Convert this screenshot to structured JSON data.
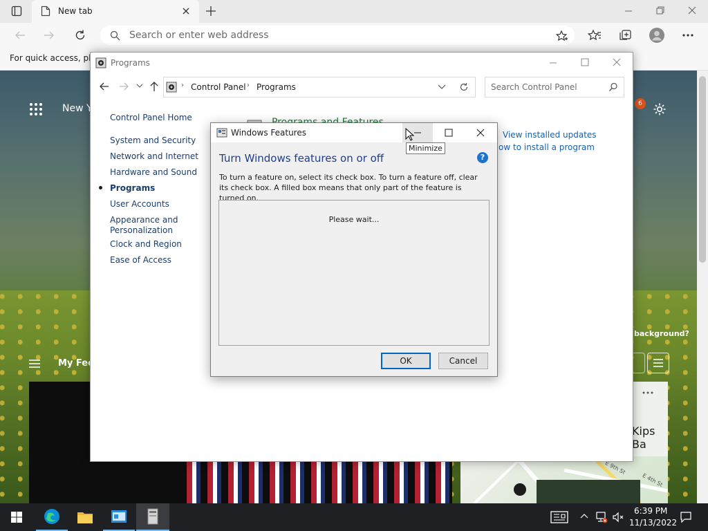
{
  "browser": {
    "tab_title": "New tab",
    "address_placeholder": "Search or enter web address",
    "favorites_text": "For quick access, plac"
  },
  "ntp": {
    "greeting": "New Y",
    "notification_count": "6",
    "my_feed": "My Fee",
    "background_question": "background?",
    "map_title": "Kips Ba",
    "map_streets": [
      "E 9th St",
      "E 4th St"
    ]
  },
  "control_panel": {
    "title": "Programs",
    "breadcrumb": [
      "Control Panel",
      "Programs"
    ],
    "search_placeholder": "Search Control Panel",
    "sidebar_home": "Control Panel Home",
    "categories": [
      "System and Security",
      "Network and Internet",
      "Hardware and Sound",
      "Programs",
      "User Accounts",
      "Appearance and Personalization",
      "Clock and Region",
      "Ease of Access"
    ],
    "current_category": "Programs",
    "section_heading": "Programs and Features",
    "links": [
      "View installed updates",
      "How to install a program"
    ]
  },
  "dialog": {
    "title": "Windows Features",
    "heading": "Turn Windows features on or off",
    "description": "To turn a feature on, select its check box. To turn a feature off, clear its check box. A filled box means that only part of the feature is turned on.",
    "loading": "Please wait...",
    "ok": "OK",
    "cancel": "Cancel",
    "tooltip": "Minimize"
  },
  "taskbar": {
    "time": "6:39 PM",
    "date": "11/13/2022"
  },
  "colors": {
    "accent": "#0067c0",
    "link": "#1a5fa8",
    "help_icon": "#1e73cf",
    "badge": "#d9541e"
  }
}
